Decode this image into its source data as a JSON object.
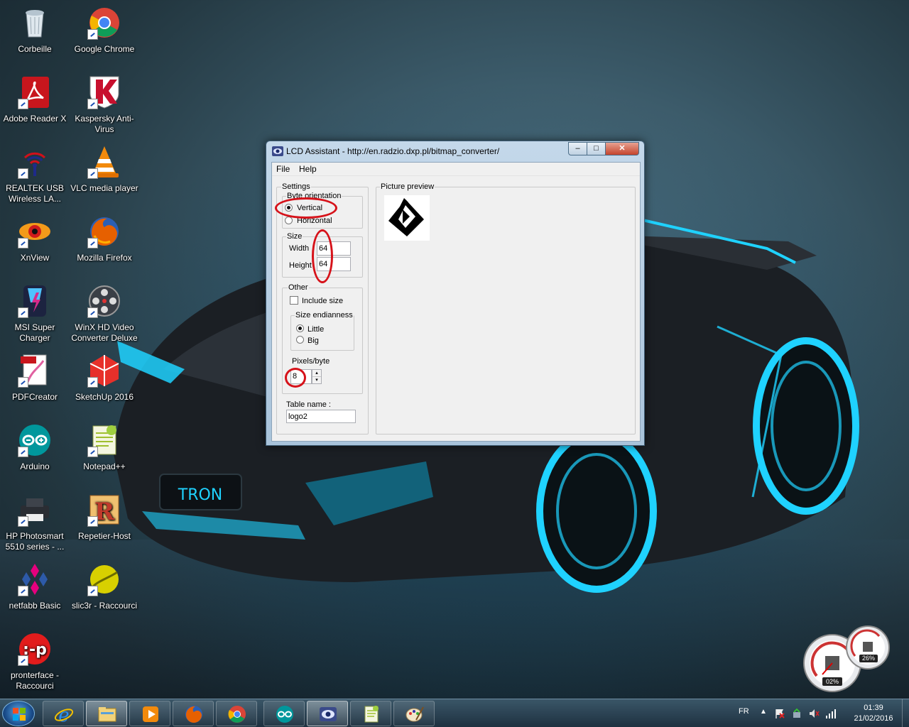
{
  "desktop": {
    "icons": [
      {
        "label": "Corbeille",
        "icon": "recycle-bin-icon"
      },
      {
        "label": "Google Chrome",
        "icon": "chrome-icon"
      },
      {
        "label": "Adobe Reader X",
        "icon": "adobe-reader-icon"
      },
      {
        "label": "Kaspersky Anti-Virus",
        "icon": "kaspersky-icon"
      },
      {
        "label": "REALTEK USB Wireless LA...",
        "icon": "wireless-icon"
      },
      {
        "label": "VLC media player",
        "icon": "vlc-icon"
      },
      {
        "label": "XnView",
        "icon": "xnview-icon"
      },
      {
        "label": "Mozilla Firefox",
        "icon": "firefox-icon"
      },
      {
        "label": "MSI Super Charger",
        "icon": "msi-icon"
      },
      {
        "label": "WinX HD Video Converter Deluxe",
        "icon": "winx-icon"
      },
      {
        "label": "PDFCreator",
        "icon": "pdfcreator-icon"
      },
      {
        "label": "SketchUp 2016",
        "icon": "sketchup-icon"
      },
      {
        "label": "Arduino",
        "icon": "arduino-icon"
      },
      {
        "label": "Notepad++",
        "icon": "notepadpp-icon"
      },
      {
        "label": "HP Photosmart 5510 series - ...",
        "icon": "printer-icon"
      },
      {
        "label": "Repetier-Host",
        "icon": "repetier-icon"
      },
      {
        "label": "netfabb Basic",
        "icon": "netfabb-icon"
      },
      {
        "label": "slic3r - Raccourci",
        "icon": "slic3r-icon"
      },
      {
        "label": "pronterface - Raccourci",
        "icon": "pronterface-icon"
      }
    ],
    "wallpaper_text": "TRON"
  },
  "window": {
    "title": "LCD Assistant -  http://en.radzio.dxp.pl/bitmap_converter/",
    "minimize": "–",
    "maximize": "□",
    "close": "✕",
    "menu": [
      "File",
      "Help"
    ],
    "settings": {
      "legend": "Settings",
      "byte_orientation": {
        "legend": "Byte orientation",
        "options": [
          "Vertical",
          "Horizontal"
        ],
        "selected": "Vertical"
      },
      "size": {
        "legend": "Size",
        "width_label": "Width",
        "width_value": "64",
        "height_label": "Height",
        "height_value": "64"
      },
      "other": {
        "legend": "Other",
        "include_size_label": "Include size",
        "include_size_checked": false,
        "endianness": {
          "legend": "Size endianness",
          "options": [
            "Little",
            "Big"
          ],
          "selected": "Little"
        },
        "pixels_per_byte_label": "Pixels/byte",
        "pixels_per_byte_value": "8"
      },
      "table_name_label": "Table name :",
      "table_name_value": "logo2"
    },
    "preview": {
      "legend": "Picture preview"
    }
  },
  "gadgets": {
    "cpu": "02%",
    "ram": "26%"
  },
  "taskbar": {
    "items": [
      "ie-icon",
      "explorer-icon",
      "media-player-icon",
      "firefox-icon",
      "chrome-icon",
      "arduino-icon",
      "lcd-assistant-icon",
      "notepadpp-icon",
      "paint-icon"
    ],
    "active": "lcd-assistant-icon"
  },
  "tray": {
    "language": "FR",
    "time": "01:39",
    "date": "21/02/2016"
  },
  "colors": {
    "annotation_red": "#d6121a",
    "accent_cyan": "#1fd2ff"
  }
}
